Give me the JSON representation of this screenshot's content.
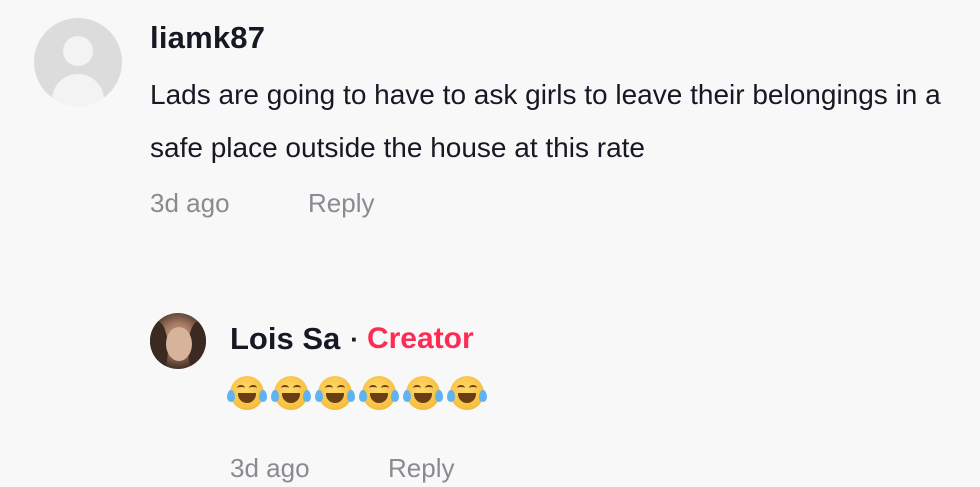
{
  "comment": {
    "username": "liamk87",
    "text": "Lads are going to have to ask girls to leave their belongings in a safe place outside the house at this rate",
    "time": "3d ago",
    "reply_label": "Reply",
    "avatar_icon": "default-user-avatar-icon"
  },
  "reply": {
    "username": "Lois Sa",
    "separator": "·",
    "badge": "Creator",
    "badge_color": "#fe2c55",
    "emojis": [
      "joy-emoji-icon",
      "joy-emoji-icon",
      "joy-emoji-icon",
      "joy-emoji-icon",
      "joy-emoji-icon",
      "joy-emoji-icon"
    ],
    "emoji_text": "😂😂😂😂😂😂",
    "time": "3d ago",
    "reply_label": "Reply"
  },
  "colors": {
    "background": "#f8f8f8",
    "text_primary": "#161823",
    "text_secondary": "#8a8b91"
  }
}
